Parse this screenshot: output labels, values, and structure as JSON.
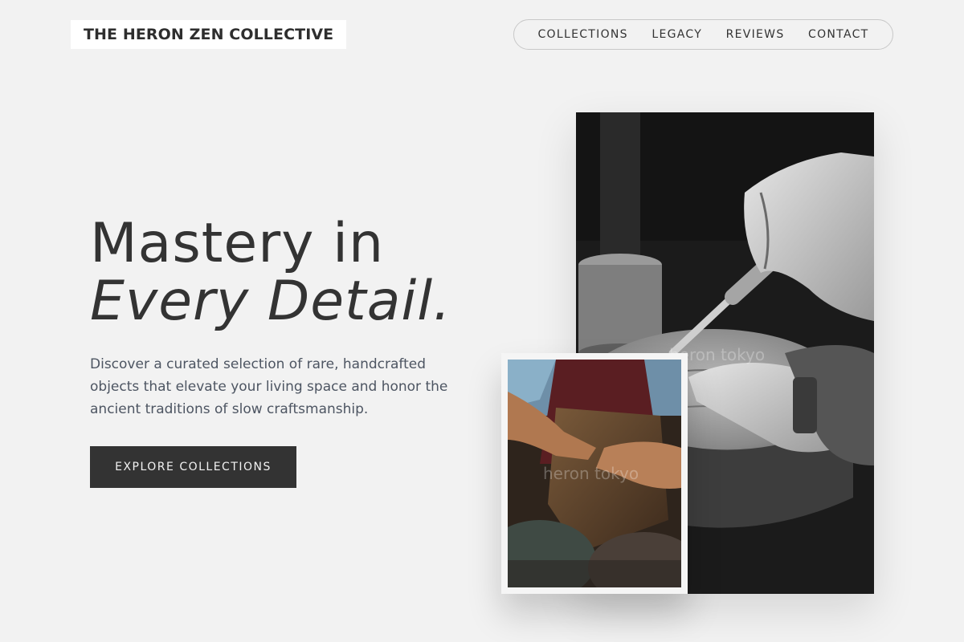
{
  "brand": {
    "name": "THE HERON ZEN COLLECTIVE"
  },
  "nav": {
    "items": [
      {
        "label": "COLLECTIONS"
      },
      {
        "label": "LEGACY"
      },
      {
        "label": "REVIEWS"
      },
      {
        "label": "CONTACT"
      }
    ]
  },
  "hero": {
    "title_line1": "Mastery in",
    "title_line2": "Every Detail.",
    "description": "Discover a curated selection of rare, handcrafted objects that elevate your living space and honor the ancient traditions of slow craftsmanship.",
    "cta_label": "EXPLORE COLLECTIONS"
  },
  "images": {
    "main_watermark": "heron tokyo",
    "inset_watermark": "heron tokyo"
  },
  "colors": {
    "background": "#f2f2f2",
    "text": "#333333",
    "muted_text": "#4d5562",
    "button_bg": "#333333"
  }
}
